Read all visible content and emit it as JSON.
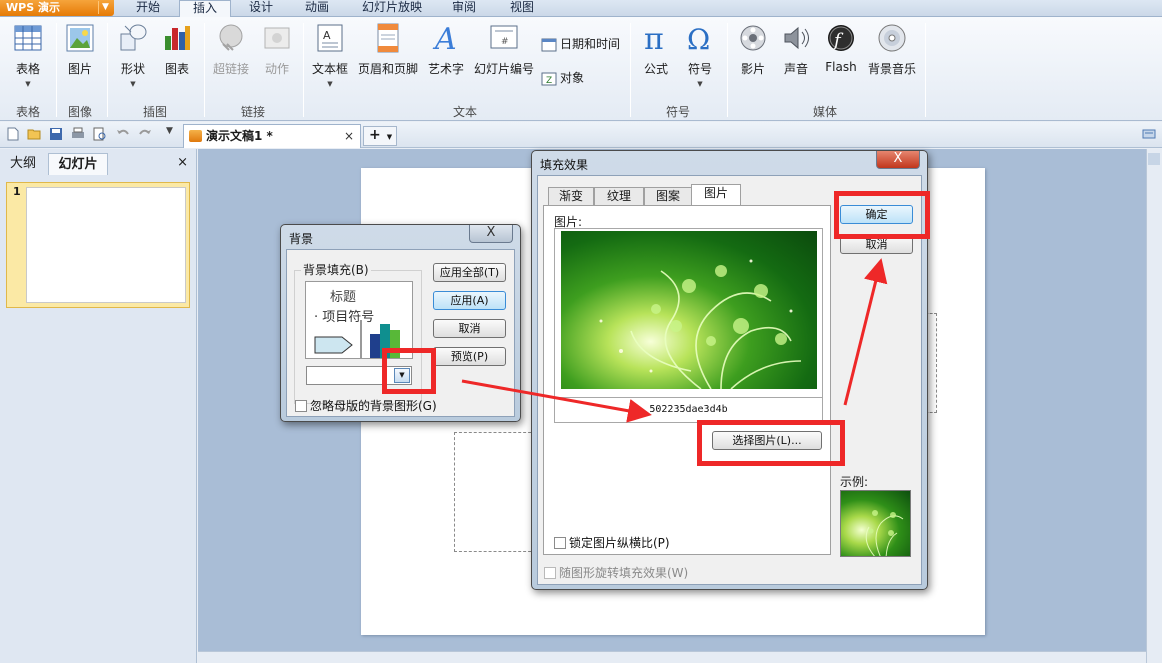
{
  "app": {
    "name": "WPS 演示",
    "menu_tabs": [
      "开始",
      "插入",
      "设计",
      "动画",
      "幻灯片放映",
      "审阅",
      "视图"
    ],
    "active_menu_tab": "插入"
  },
  "ribbon": {
    "buttons": {
      "table": "表格",
      "picture": "图片",
      "shape": "形状",
      "chart": "图表",
      "hyperlink": "超链接",
      "action": "动作",
      "textbox": "文本框",
      "header_footer": "页眉和页脚",
      "wordart": "艺术字",
      "slide_number": "幻灯片编号",
      "datetime": "日期和时间",
      "object": "对象",
      "formula": "公式",
      "symbol": "符号",
      "movie": "影片",
      "sound": "声音",
      "flash": "Flash",
      "bg_music": "背景音乐"
    },
    "groups": {
      "table": "表格",
      "image": "图像",
      "illustration": "插图",
      "link": "链接",
      "text": "文本",
      "symbol": "符号",
      "media": "媒体"
    },
    "icons": [
      "table-icon",
      "picture-icon",
      "shape-icon",
      "chart-icon",
      "hyperlink-icon",
      "action-icon",
      "textbox-icon",
      "header-footer-icon",
      "wordart-icon",
      "slide-number-icon",
      "datetime-icon",
      "object-icon",
      "pi-icon",
      "omega-icon",
      "film-icon",
      "speaker-icon",
      "flash-icon",
      "cd-icon"
    ]
  },
  "quick_bar": {
    "doc_tab": "演示文稿1 *",
    "close": "×",
    "new_tab": "+"
  },
  "left_pane": {
    "tab_outline": "大纲",
    "tab_slides": "幻灯片",
    "close": "×",
    "slide_number": "1"
  },
  "bg_dialog": {
    "title": "背景",
    "close": "X",
    "fill_label": "背景填充(B)",
    "preview_title": "标题",
    "preview_bullet": "项目符号",
    "btn_apply_all": "应用全部(T)",
    "btn_apply": "应用(A)",
    "btn_cancel": "取消",
    "btn_preview": "预览(P)",
    "ignore_master": "忽略母版的背景图形(G)",
    "chart_colors": [
      "#1f3f8c",
      "#7b3fa0",
      "#0f8f8f",
      "#58b838"
    ]
  },
  "fill_dialog": {
    "title": "填充效果",
    "close": "X",
    "tabs": [
      "渐变",
      "纹理",
      "图案",
      "图片"
    ],
    "active_tab": "图片",
    "picture_label": "图片:",
    "picture_name": "502235dae3d4b",
    "btn_select": "选择图片(L)...",
    "lock_ratio": "锁定图片纵横比(P)",
    "rotate_with_shape": "随图形旋转填充效果(W)",
    "btn_ok": "确定",
    "btn_cancel": "取消",
    "sample_label": "示例:"
  },
  "colors": {
    "highlight": "#ee2828",
    "accent_orange": "#e57a06",
    "workspace_bg": "#a9bdd6",
    "thumb_selected": "#fbe9a5"
  }
}
